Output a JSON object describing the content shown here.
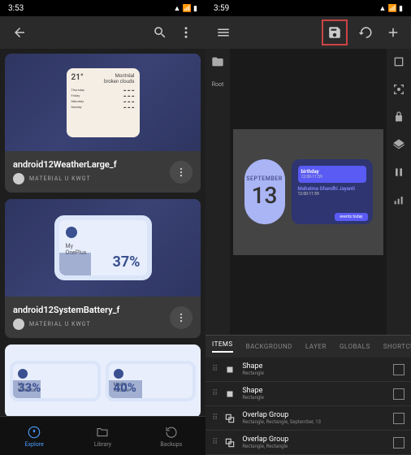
{
  "left": {
    "status_time": "3:53",
    "cards": [
      {
        "title": "android12WeatherLarge_f",
        "author": "MATERIAL U KWGT",
        "weather": {
          "city": "Montréal",
          "cond": "broken clouds",
          "temp": "21°",
          "days": [
            "Thursday",
            "Friday",
            "Saturday",
            "Sunday"
          ]
        }
      },
      {
        "title": "android12SystemBattery_f",
        "author": "MATERIAL U KWGT",
        "battery": {
          "device": "My\nOnePlus",
          "pct": "37%"
        }
      },
      {
        "dual": [
          {
            "label": "My\nOnePlus",
            "pct": "33%",
            "w": "33%"
          },
          {
            "label": "Media\nvolume",
            "pct": "40%",
            "w": "40%"
          }
        ]
      }
    ],
    "nav": {
      "explore": "Explore",
      "library": "Library",
      "backups": "Backups"
    }
  },
  "right": {
    "status_time": "3:59",
    "root_label": "Root",
    "canvas": {
      "month": "SEPTEMBER",
      "day": "13",
      "event1": {
        "title": "birthday",
        "time": "12:00-11:59"
      },
      "event2": {
        "title": "Mahatma Ghandhi Jayanti",
        "time": "12:00-11:59"
      },
      "footer": "events today"
    },
    "tabs": {
      "items": "ITEMS",
      "background": "BACKGROUND",
      "layer": "LAYER",
      "globals": "GLOBALS",
      "shortcuts": "SHORTCU"
    },
    "layers": [
      {
        "name": "Shape",
        "sub": "Rectangle"
      },
      {
        "name": "Shape",
        "sub": "Rectangle"
      },
      {
        "name": "Overlap Group",
        "sub": "Rectangle, Rectangle, September, 13"
      },
      {
        "name": "Overlap Group",
        "sub": "Rectangle, Rectangle"
      }
    ]
  }
}
